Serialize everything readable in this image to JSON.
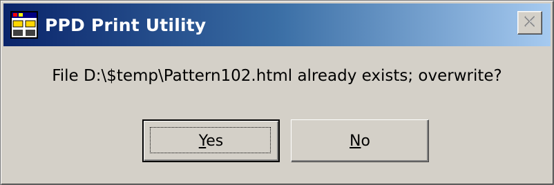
{
  "window": {
    "title": "PPD Print Utility",
    "icon": "application-window-icon",
    "close_icon": "close-x-icon"
  },
  "dialog": {
    "message": "File D:\\$temp\\Pattern102.html already exists; overwrite?",
    "buttons": [
      {
        "label": "Yes",
        "mnemonic": "Y",
        "rest": "es",
        "default": true
      },
      {
        "label": "No",
        "mnemonic": "N",
        "rest": "o",
        "default": false
      }
    ]
  },
  "colors": {
    "titlebar_start": "#0a246a",
    "titlebar_end": "#a6caf0",
    "face": "#d4d0c8"
  }
}
